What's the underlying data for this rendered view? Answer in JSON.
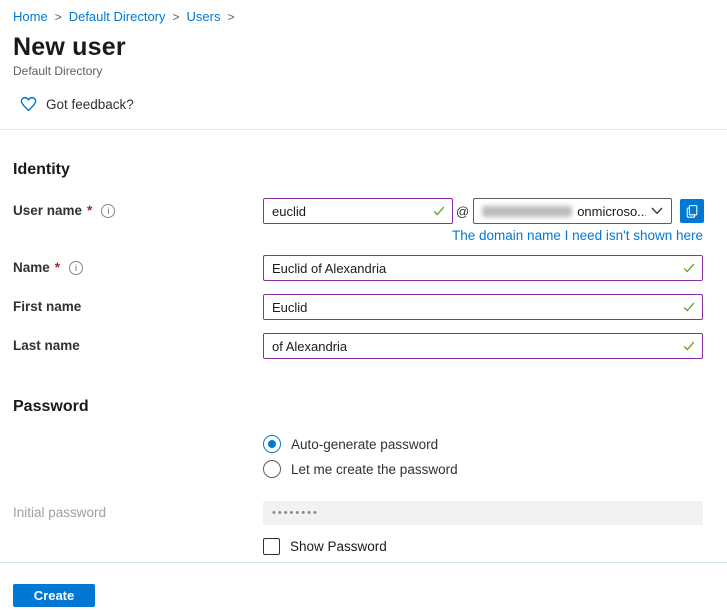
{
  "breadcrumb": {
    "items": [
      "Home",
      "Default Directory",
      "Users"
    ],
    "separator": ">"
  },
  "header": {
    "title": "New user",
    "subtitle": "Default Directory"
  },
  "feedback": {
    "label": "Got feedback?"
  },
  "identity": {
    "heading": "Identity",
    "username": {
      "label": "User name",
      "required": "*",
      "value": "euclid",
      "at_symbol": "@",
      "domain_suffix": "onmicroso...",
      "domain_link": "The domain name I need isn't shown here"
    },
    "name": {
      "label": "Name",
      "required": "*",
      "value": "Euclid of Alexandria"
    },
    "first_name": {
      "label": "First name",
      "value": "Euclid"
    },
    "last_name": {
      "label": "Last name",
      "value": "of Alexandria"
    }
  },
  "password": {
    "heading": "Password",
    "options": [
      {
        "label": "Auto-generate password",
        "selected": true
      },
      {
        "label": "Let me create the password",
        "selected": false
      }
    ],
    "initial": {
      "label": "Initial password",
      "value": "••••••••"
    },
    "show_password": {
      "label": "Show Password",
      "checked": false
    }
  },
  "footer": {
    "create_label": "Create"
  },
  "icons": {
    "info_glyph": "i"
  },
  "colors": {
    "accent": "#0078d4",
    "input_valid_border": "#8a2da5",
    "success_check": "#5ea32a",
    "required_asterisk": "#a4262c",
    "disabled_bg": "#f3f2f1"
  }
}
